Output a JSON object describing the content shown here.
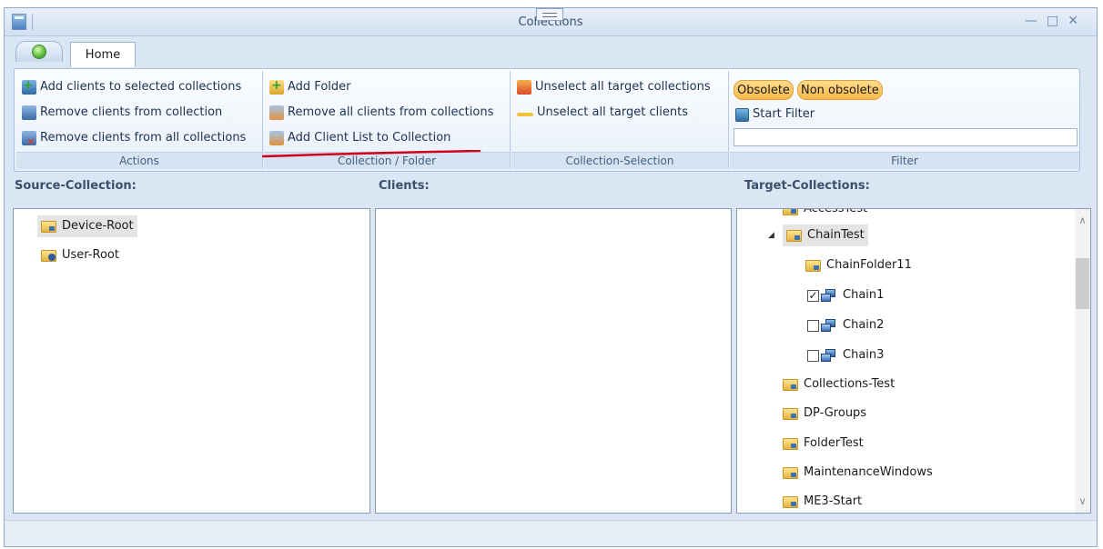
{
  "window": {
    "title": "Collections"
  },
  "tabs": {
    "home": "Home"
  },
  "ribbon": {
    "actions": {
      "label": "Actions",
      "items": [
        "Add clients to selected collections",
        "Remove clients from collection",
        "Remove clients from all collections"
      ]
    },
    "collection_folder": {
      "label": "Collection / Folder",
      "items": [
        "Add Folder",
        "Remove all clients from collections",
        "Add Client List to Collection"
      ]
    },
    "collection_selection": {
      "label": "Collection-Selection",
      "items": [
        "Unselect all target collections",
        "Unselect all target clients"
      ]
    },
    "filter": {
      "label": "Filter",
      "obsolete": "Obsolete",
      "non_obsolete": "Non obsolete",
      "start_filter": "Start Filter",
      "input_value": ""
    }
  },
  "panels": {
    "source": {
      "header": "Source-Collection:",
      "items": [
        "Device-Root",
        "User-Root"
      ]
    },
    "clients": {
      "header": "Clients:"
    },
    "target": {
      "header": "Target-Collections:",
      "partial_top": "AccessTest",
      "items": [
        {
          "label": "ChainTest"
        },
        {
          "label": "ChainFolder11"
        },
        {
          "label": "Chain1",
          "checked": true
        },
        {
          "label": "Chain2",
          "checked": false
        },
        {
          "label": "Chain3",
          "checked": false
        },
        {
          "label": "Collections-Test"
        },
        {
          "label": "DP-Groups"
        },
        {
          "label": "FolderTest"
        },
        {
          "label": "MaintenanceWindows"
        },
        {
          "label": "ME3-Start"
        }
      ]
    }
  },
  "annotation": {
    "underline_color": "#d0021b"
  }
}
